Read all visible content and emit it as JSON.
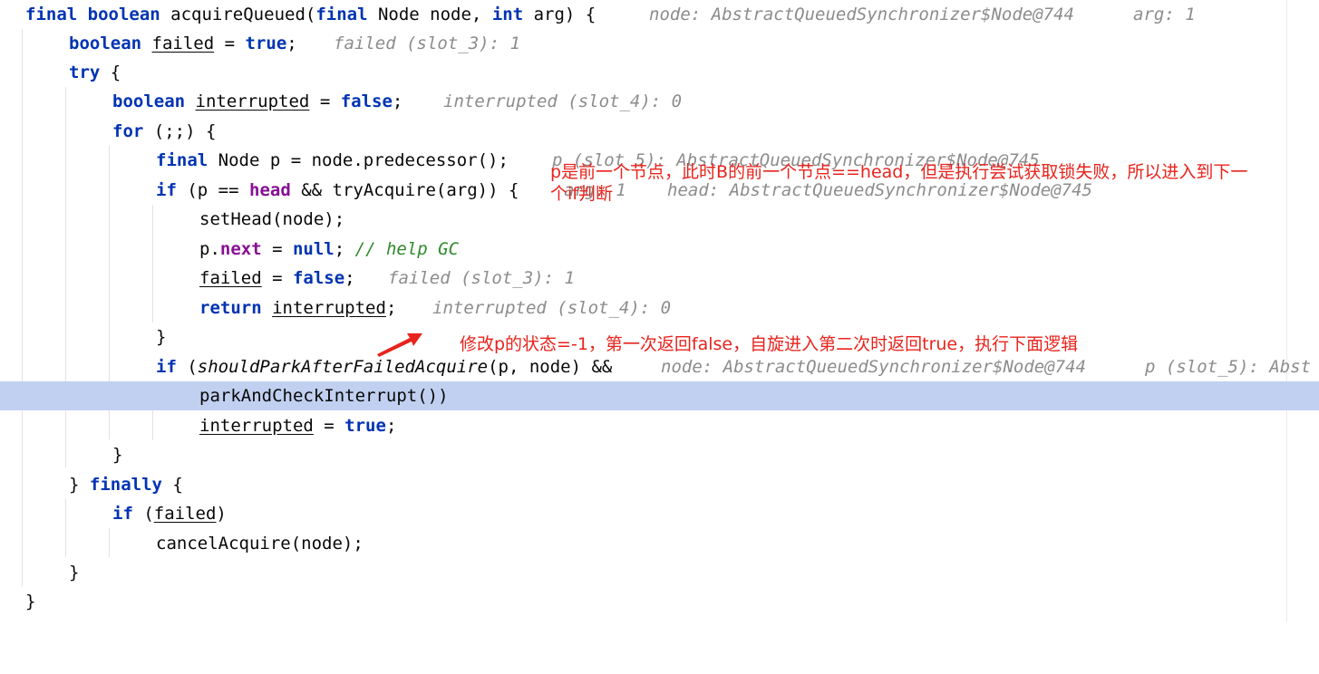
{
  "code": {
    "l1": {
      "kw1": "final",
      "kw2": "boolean",
      "text": " acquireQueued(",
      "kw3": "final",
      "text2": " Node node, ",
      "kw4": "int",
      "text3": " arg) {",
      "hint_node": "node: AbstractQueuedSynchronizer$Node@744",
      "hint_arg": "arg: 1"
    },
    "l2": {
      "kw1": "boolean",
      "var": "failed",
      "text": " = ",
      "kw2": "true",
      "text2": ";",
      "hint": "failed (slot_3): 1"
    },
    "l3": {
      "kw1": "try",
      "text": " {"
    },
    "l4": {
      "kw1": "boolean",
      "var": "interrupted",
      "text": " = ",
      "kw2": "false",
      "text2": ";",
      "hint": "interrupted (slot_4): 0"
    },
    "l5": {
      "kw1": "for",
      "text": " (;;) {"
    },
    "l6": {
      "kw1": "final",
      "text": " Node p = node.predecessor();",
      "hint": "p (slot_5): AbstractQueuedSynchronizer$Node@745"
    },
    "l7": {
      "kw1": "if",
      "text": " (p ",
      "op": "==",
      "field": "head",
      "text2": " && tryAcquire(arg)) {",
      "hint_arg": "arg: 1",
      "hint_head": "head: AbstractQueuedSynchronizer$Node@745"
    },
    "l8": {
      "text": "setHead(node);"
    },
    "l9": {
      "text": "p.",
      "field": "next",
      "text2": " = ",
      "kw1": "null",
      "text3": "; ",
      "comment": "// help GC"
    },
    "l10": {
      "var": "failed",
      "text": " = ",
      "kw1": "false",
      "text2": ";",
      "hint": "failed (slot_3): 1"
    },
    "l11": {
      "kw1": "return",
      "var": "interrupted",
      "text": ";",
      "hint": "interrupted (slot_4): 0"
    },
    "l12": {
      "text": "}"
    },
    "l13": {
      "kw1": "if",
      "text": " (",
      "ital": "shouldParkAfterFailedAcquire",
      "text2": "(p, node) &&",
      "hint_node": "node: AbstractQueuedSynchronizer$Node@744",
      "hint_p": "p (slot_5): Abst"
    },
    "l14": {
      "text": "parkAndCheckInterrupt())"
    },
    "l15": {
      "var": "interrupted",
      "text": " = ",
      "kw1": "true",
      "text2": ";"
    },
    "l16": {
      "text": "}"
    },
    "l17": {
      "text": "} ",
      "kw1": "finally",
      "text2": " {"
    },
    "l18": {
      "kw1": "if",
      "text": " (",
      "var": "failed",
      "text2": ")"
    },
    "l19": {
      "text": "cancelAcquire(node);"
    },
    "l20": {
      "text": "}"
    },
    "l21": {
      "text": "}"
    }
  },
  "annotations": {
    "note1_line1": "p是前一个节点，此时B的前一个节点==head，但是执行尝试获取锁失败，所以进入到下一",
    "note1_line2": "个if判断",
    "note2": "修改p的状态=-1，第一次返回false，自旋进入第二次时返回true，执行下面逻辑"
  },
  "colors": {
    "keyword": "#0033b3",
    "field": "#871094",
    "comment": "#2d8a2d",
    "hint": "#8c8c8c",
    "highlight": "#c1d0f0",
    "annotation": "#e8231c"
  }
}
